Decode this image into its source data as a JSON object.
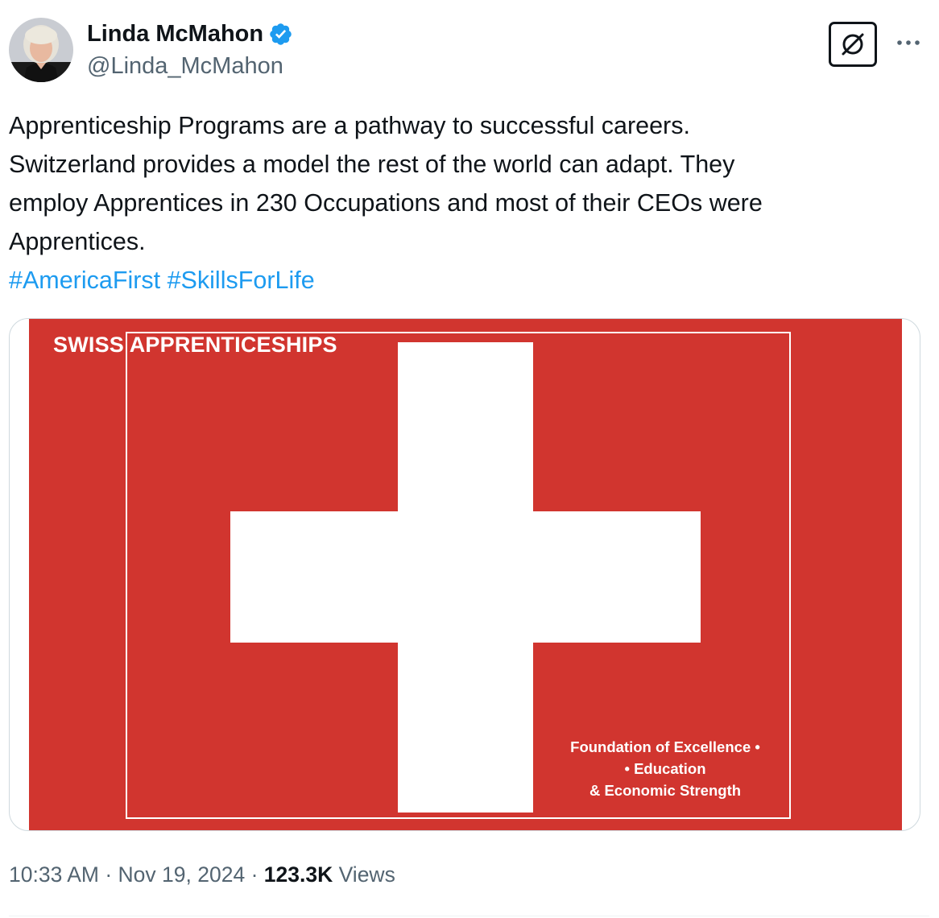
{
  "author": {
    "display_name": "Linda McMahon",
    "handle": "@Linda_McMahon",
    "verified": true,
    "avatar_icon": "profile-photo"
  },
  "header_actions": {
    "grok_icon": "grok-icon",
    "more_icon": "more-horizontal-icon"
  },
  "tweet": {
    "lines": [
      "Apprenticeship Programs are a pathway to successful careers.",
      "Switzerland provides a model the rest of the world can adapt. They",
      "employ Apprentices in 230 Occupations and most of their CEOs were",
      "Apprentices."
    ],
    "hashtags": [
      "#AmericaFirst",
      "#SkillsForLife"
    ]
  },
  "media": {
    "title": "SWISS APPRENTICESHIPS",
    "caption_lines": [
      "Foundation of Excellence •",
      "• Education",
      "& Economic Strength"
    ],
    "colors": {
      "flag_red": "#d1352f",
      "cross": "#ffffff"
    }
  },
  "meta": {
    "time": "10:33 AM",
    "separator": "·",
    "date": "Nov 19, 2024",
    "views_count": "123.3K",
    "views_label": "Views"
  },
  "colors": {
    "link": "#1d9bf0",
    "verified_badge": "#1d9bf0",
    "secondary_text": "#536471",
    "primary_text": "#0f1419"
  }
}
